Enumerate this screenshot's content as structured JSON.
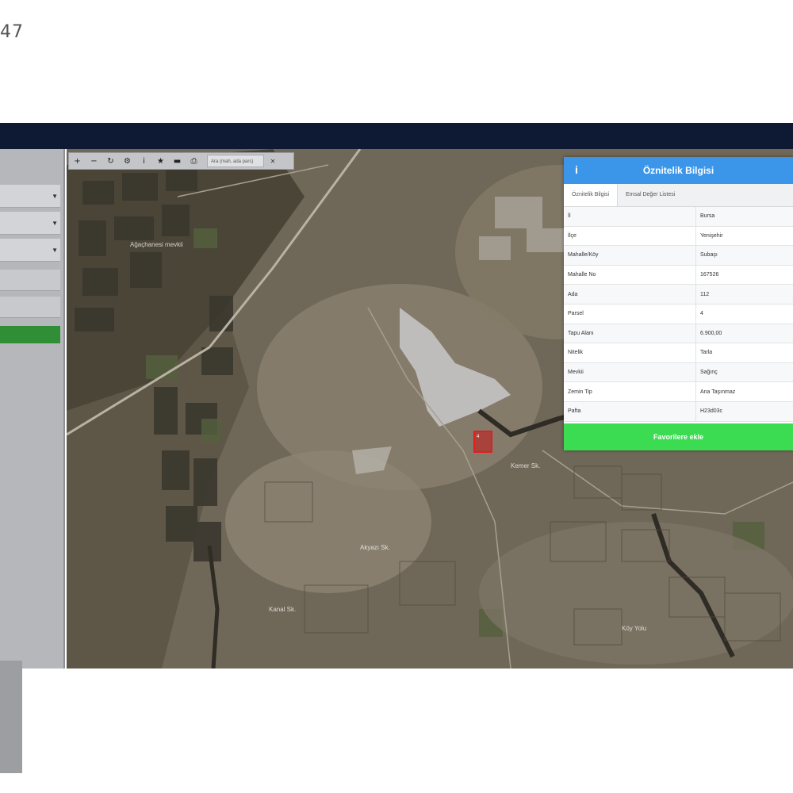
{
  "page_number": "47",
  "map_toolbar": {
    "buttons": [
      {
        "name": "zoom-in-icon",
        "glyph": "+"
      },
      {
        "name": "zoom-out-icon",
        "glyph": "−"
      },
      {
        "name": "refresh-icon",
        "glyph": "↻"
      },
      {
        "name": "settings-icon",
        "glyph": "⚙"
      },
      {
        "name": "info-icon",
        "glyph": "i"
      },
      {
        "name": "star-icon",
        "glyph": "★"
      },
      {
        "name": "measure-icon",
        "glyph": "▬"
      },
      {
        "name": "print-icon",
        "glyph": "⎙"
      }
    ],
    "search_text": "Ara (mah, ada pars)",
    "close_glyph": "✕"
  },
  "map_labels": [
    "Ağaçhanesi mevkii",
    "Kemer Sk.",
    "Akyazı Sk.",
    "Kanal Sk.",
    "Köy Yolu"
  ],
  "parcel_label": "4",
  "panel": {
    "title": "Öznitelik Bilgisi",
    "info_glyph": "i",
    "tabs": [
      "Öznitelik Bilgisi",
      "Emsal Değer Listesi"
    ],
    "rows": [
      {
        "key": "İl",
        "value": "Bursa"
      },
      {
        "key": "İlçe",
        "value": "Yenişehir"
      },
      {
        "key": "Mahalle/Köy",
        "value": "Subaşı"
      },
      {
        "key": "Mahalle No",
        "value": "167526"
      },
      {
        "key": "Ada",
        "value": "112"
      },
      {
        "key": "Parsel",
        "value": "4"
      },
      {
        "key": "Tapu Alanı",
        "value": "6.900,00"
      },
      {
        "key": "Nitelik",
        "value": "Tarla"
      },
      {
        "key": "Mevkii",
        "value": "Sağınç"
      },
      {
        "key": "Zemin Tip",
        "value": "Ana Taşınmaz"
      },
      {
        "key": "Pafta",
        "value": "H23d03c"
      }
    ],
    "favorite_button": "Favorilere ekle"
  },
  "colors": {
    "topbar": "#0e1a33",
    "sidebar": "#b6b7ba",
    "sidebar_button": "#2f8e36",
    "panel_header": "#3b96ea",
    "panel_button": "#3cdc52",
    "parcel": "#e02020"
  }
}
